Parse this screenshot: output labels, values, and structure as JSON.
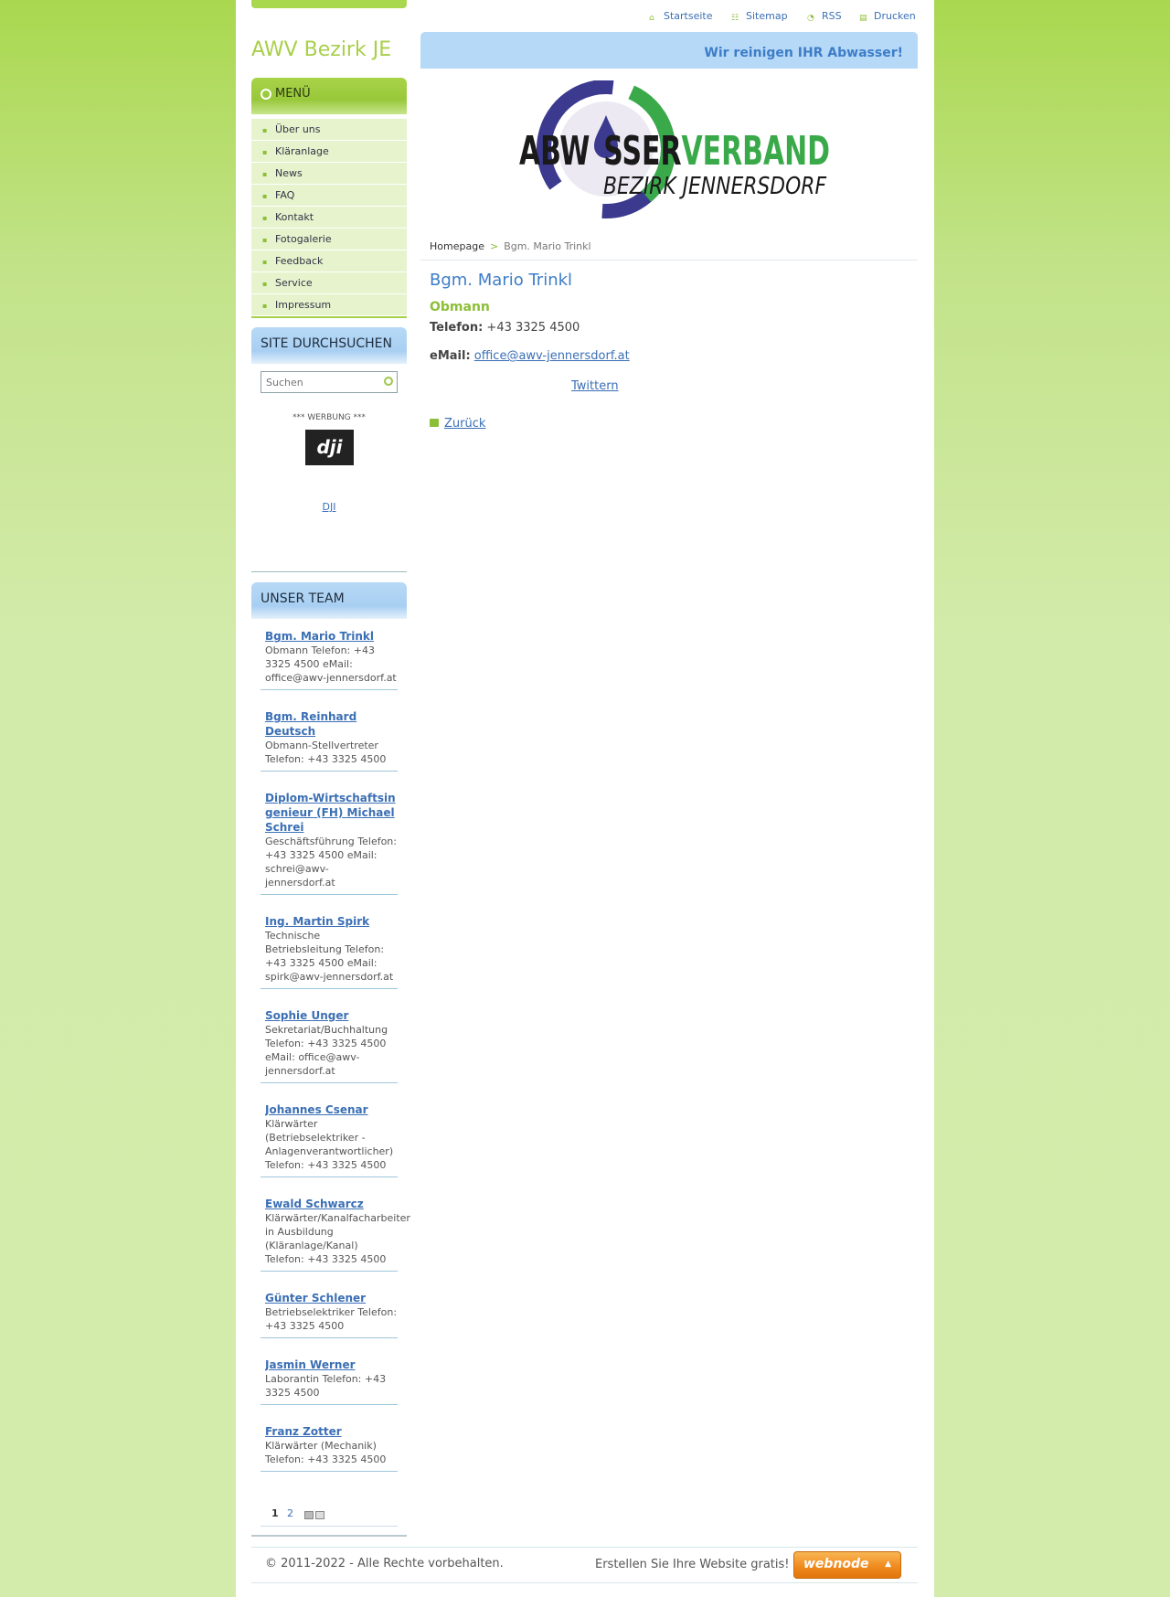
{
  "site": {
    "title": "AWV Bezirk JE",
    "slogan": "Wir reinigen IHR Abwasser!"
  },
  "toplinks": [
    "Startseite",
    "Sitemap",
    "RSS",
    "Drucken"
  ],
  "menu": {
    "heading": "MENÜ",
    "items": [
      "Über uns",
      "Kläranlage",
      "News",
      "FAQ",
      "Kontakt",
      "Fotogalerie",
      "Feedback",
      "Service",
      "Impressum"
    ]
  },
  "search": {
    "heading": "SITE DURCHSUCHEN",
    "placeholder": "Suchen"
  },
  "ad": {
    "label": "*** WERBUNG ***",
    "logo_text": "dji",
    "link": "DJI"
  },
  "team": {
    "heading": "UNSER TEAM",
    "members": [
      {
        "name": "Bgm. Mario Trinkl",
        "desc": "Obmann Telefon: +43 3325 4500 eMail: office@awv-jennersdorf.at"
      },
      {
        "name": "Bgm. Reinhard Deutsch",
        "desc": "Obmann-Stellvertreter Telefon: +43 3325 4500"
      },
      {
        "name": "Diplom-Wirtschaftsingenieur (FH) Michael Schrei",
        "desc": "Geschäftsführung Telefon: +43 3325 4500 eMail:  schrei@awv-jennersdorf.at"
      },
      {
        "name": "Ing. Martin Spirk",
        "desc": "Technische Betriebsleitung Telefon: +43 3325 4500 eMail: spirk@awv-jennersdorf.at"
      },
      {
        "name": "Sophie Unger",
        "desc": "Sekretariat/Buchhaltung Telefon: +43 3325 4500 eMail: office@awv-jennersdorf.at"
      },
      {
        "name": "Johannes Csenar",
        "desc": "Klärwärter (Betriebselektriker - Anlagenverantwortlicher) Telefon: +43 3325 4500"
      },
      {
        "name": "Ewald Schwarcz",
        "desc": "Klärwärter/Kanalfacharbeiter in Ausbildung (Kläranlage/Kanal) Telefon: +43 3325 4500"
      },
      {
        "name": "Günter Schlener",
        "desc": "Betriebselektriker Telefon: +43 3325 4500"
      },
      {
        "name": "Jasmin Werner",
        "desc": "Laborantin Telefon: +43 3325 4500"
      },
      {
        "name": "Franz Zotter",
        "desc": "Klärwärter  (Mechanik) Telefon: +43 3325 4500"
      }
    ],
    "pages": [
      "1",
      "2"
    ]
  },
  "logo": {
    "line1_a": "ABW",
    "line1_b": "SSER",
    "line1_c": "VERBAND",
    "line2": "BEZIRK JENNERSDORF"
  },
  "breadcrumb": {
    "home": "Homepage",
    "sep": ">",
    "current": "Bgm. Mario Trinkl"
  },
  "content": {
    "title": "Bgm. Mario Trinkl",
    "role": "Obmann",
    "phone_label": "Telefon:",
    "phone": "+43 3325 4500",
    "email_label": "eMail:",
    "email": "office@awv-jennersdorf.at",
    "twitter": "Twittern",
    "back": "Zurück"
  },
  "footer": {
    "copyright": "© 2011-2022 - Alle Rechte vorbehalten.",
    "create": "Erstellen Sie Ihre Website gratis!",
    "button": "webnode"
  },
  "colors": {
    "accent_green": "#8cbe37",
    "link_blue": "#3b6fb5",
    "header_blue": "#b6d9f7"
  }
}
